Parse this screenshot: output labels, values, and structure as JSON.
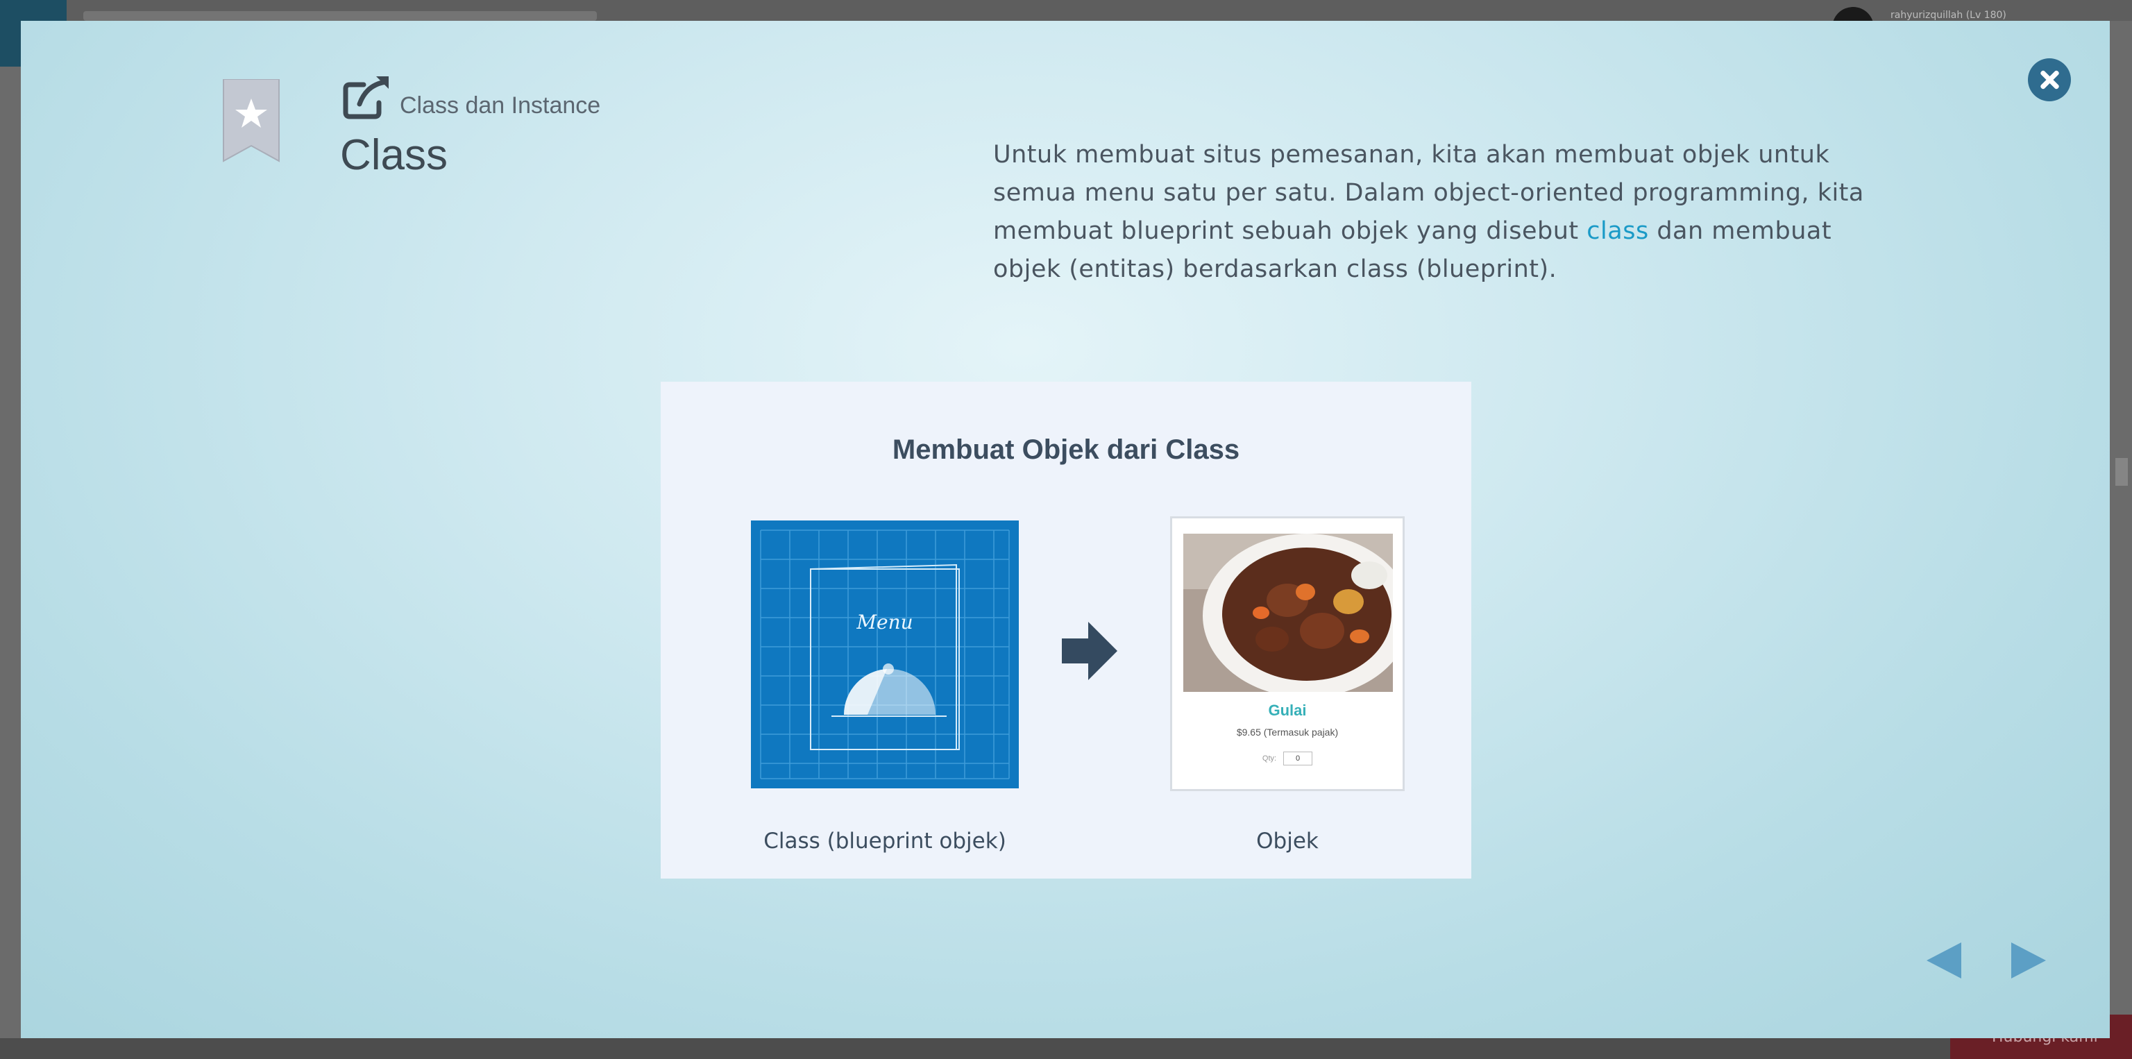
{
  "background": {
    "username": "rahyurizquillah (Lv 180)",
    "bottom_button_label": "Hubungi kami"
  },
  "modal": {
    "breadcrumb": "Class dan Instance",
    "title": "Class",
    "description_before": "Untuk membuat situs pemesanan, kita akan membuat objek untuk semua menu satu per satu. Dalam object-oriented programming, kita membuat blueprint sebuah objek yang disebut ",
    "description_highlight": "class",
    "description_after": " dan membuat objek (entitas) berdasarkan class (blueprint).",
    "highlight_color": "#1a9ac7",
    "illustration": {
      "title": "Membuat Objek dari Class",
      "blueprint_label": "Menu",
      "class_caption": "Class (blueprint objek)",
      "object_caption": "Objek",
      "food_name": "Gulai",
      "food_price": "$9.65 (Termasuk pajak)",
      "qty_label": "Qty:",
      "qty_value": "0"
    }
  },
  "icons": {
    "close": "close-icon",
    "bookmark": "bookmark-star-icon",
    "external_link": "external-link-icon",
    "prev": "triangle-left-icon",
    "next": "triangle-right-icon"
  },
  "colors": {
    "close_button": "#2f6c8f",
    "blueprint": "#0f78c0",
    "nav_arrows": "#5c9fc5"
  }
}
